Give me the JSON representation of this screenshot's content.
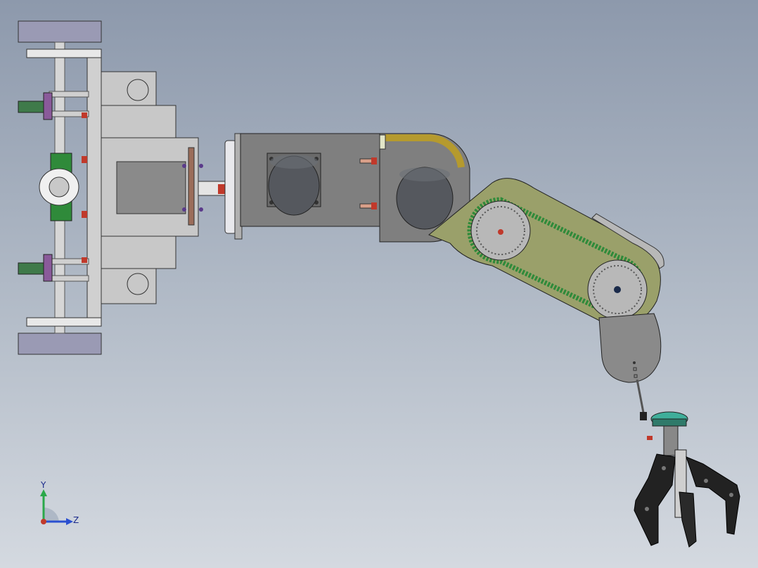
{
  "viewport": {
    "background_top": "#8d99ac",
    "background_bottom": "#d4d9e0"
  },
  "model": {
    "components": [
      "base-mount",
      "shoulder-joint",
      "upper-arm",
      "belt-forearm",
      "wrist",
      "gripper"
    ],
    "colors": {
      "gray_part": "#c8c8c8",
      "dark_gray_part": "#808080",
      "motor": "#55585e",
      "forearm_green": "#9aa06a",
      "belt_green": "#2f8a3a",
      "accent_red": "#c0392b",
      "accent_teal": "#3fae9a",
      "gripper_black": "#222222"
    }
  },
  "triad": {
    "y_label": "Y",
    "z_label": "Z",
    "y_color": "#2aa84a",
    "z_color": "#2a4fd0",
    "origin_color": "#c0392b"
  }
}
